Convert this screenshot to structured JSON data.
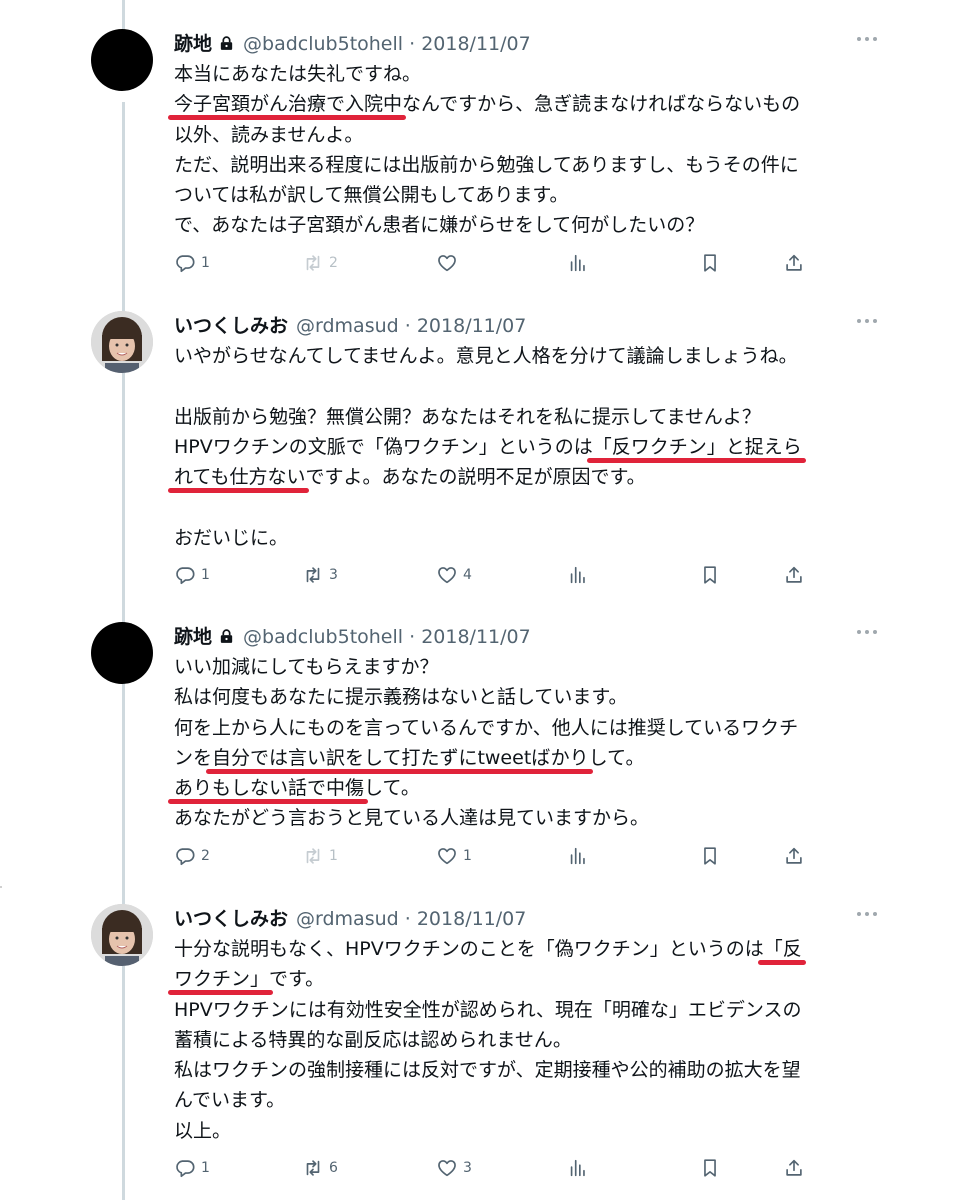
{
  "tweets": [
    {
      "name": "跡地",
      "locked": true,
      "handle": "@badclub5tohell",
      "date": "2018/11/07",
      "avatar": "black",
      "lines": [
        {
          "segments": [
            {
              "text": "本当にあなたは失礼ですね。"
            }
          ]
        },
        {
          "segments": [
            {
              "text": "今子宮頚がん治療で入院中",
              "hl": true
            },
            {
              "text": "なんですから、急ぎ読まなければならないもの"
            }
          ]
        },
        {
          "segments": [
            {
              "text": "以外、読みませんよ。"
            }
          ]
        },
        {
          "segments": [
            {
              "text": "ただ、説明出来る程度には出版前から勉強してありますし、もうその件に"
            }
          ]
        },
        {
          "segments": [
            {
              "text": "ついては私が訳して無償公開もしてあります。"
            }
          ]
        },
        {
          "segments": [
            {
              "text": "で、あなたは子宮頚がん患者に嫌がらせをして何がしたいの？"
            }
          ]
        }
      ],
      "replies": "1",
      "retweets": "2",
      "likes": "",
      "retweets_faded": true
    },
    {
      "name": "いつくしみお",
      "locked": false,
      "handle": "@rdmasud",
      "date": "2018/11/07",
      "avatar": "photo",
      "lines": [
        {
          "segments": [
            {
              "text": "いやがらせなんてしてませんよ。意見と人格を分けて議論しましょうね。"
            }
          ]
        },
        {
          "blank": true
        },
        {
          "segments": [
            {
              "text": "出版前から勉強？無償公開？あなたはそれを私に提示してませんよ？"
            }
          ]
        },
        {
          "segments": [
            {
              "text": "HPVワクチンの文脈で「偽ワクチン」というのは"
            },
            {
              "text": "「反ワクチン」と捉えら",
              "hl": true
            }
          ]
        },
        {
          "segments": [
            {
              "text": "れても仕方ない",
              "hl": true
            },
            {
              "text": "ですよ。あなたの説明不足が原因です。"
            }
          ]
        },
        {
          "blank": true
        },
        {
          "segments": [
            {
              "text": "おだいじに。"
            }
          ]
        }
      ],
      "replies": "1",
      "retweets": "3",
      "likes": "4",
      "retweets_faded": false
    },
    {
      "name": "跡地",
      "locked": true,
      "handle": "@badclub5tohell",
      "date": "2018/11/07",
      "avatar": "black",
      "lines": [
        {
          "segments": [
            {
              "text": "いい加減にしてもらえますか？"
            }
          ]
        },
        {
          "segments": [
            {
              "text": "私は何度もあなたに提示義務はないと話しています。"
            }
          ]
        },
        {
          "segments": [
            {
              "text": "何を上から人にものを言っているんですか、他人には推奨しているワクチ"
            }
          ]
        },
        {
          "segments": [
            {
              "text": "ンを"
            },
            {
              "text": "自分では言い訳をして打たずにtweetばかり",
              "hl": true
            },
            {
              "text": "して。"
            }
          ]
        },
        {
          "segments": [
            {
              "text": "ありもしない話で中傷",
              "hl": true
            },
            {
              "text": "して。"
            }
          ]
        },
        {
          "segments": [
            {
              "text": "あなたがどう言おうと見ている人達は見ていますから。"
            }
          ]
        }
      ],
      "replies": "2",
      "retweets": "1",
      "likes": "1",
      "retweets_faded": true
    },
    {
      "name": "いつくしみお",
      "locked": false,
      "handle": "@rdmasud",
      "date": "2018/11/07",
      "avatar": "photo",
      "lines": [
        {
          "segments": [
            {
              "text": "十分な説明もなく、HPVワクチンのことを「偽ワクチン」というのは"
            },
            {
              "text": "「反",
              "hl": true
            }
          ]
        },
        {
          "segments": [
            {
              "text": "ワクチン」",
              "hl": true
            },
            {
              "text": "です。"
            }
          ]
        },
        {
          "segments": [
            {
              "text": "HPVワクチンには有効性安全性が認められ、現在「明確な」エビデンスの"
            }
          ]
        },
        {
          "segments": [
            {
              "text": "蓄積による特異的な副反応は認められません。"
            }
          ]
        },
        {
          "segments": [
            {
              "text": "私はワクチンの強制接種には反対ですが、定期接種や公的補助の拡大を望"
            }
          ]
        },
        {
          "segments": [
            {
              "text": "んでいます。"
            }
          ]
        },
        {
          "segments": [
            {
              "text": "以上。"
            }
          ]
        }
      ],
      "replies": "1",
      "retweets": "6",
      "likes": "3",
      "retweets_faded": false
    }
  ],
  "colors": {
    "highlight": "#e0233a",
    "text": "#0f1419",
    "meta": "#536471",
    "thread_line": "#cfd9de"
  },
  "icons": [
    "reply-icon",
    "retweet-icon",
    "like-icon",
    "views-icon",
    "bookmark-icon",
    "share-icon",
    "lock-icon",
    "more-icon"
  ]
}
